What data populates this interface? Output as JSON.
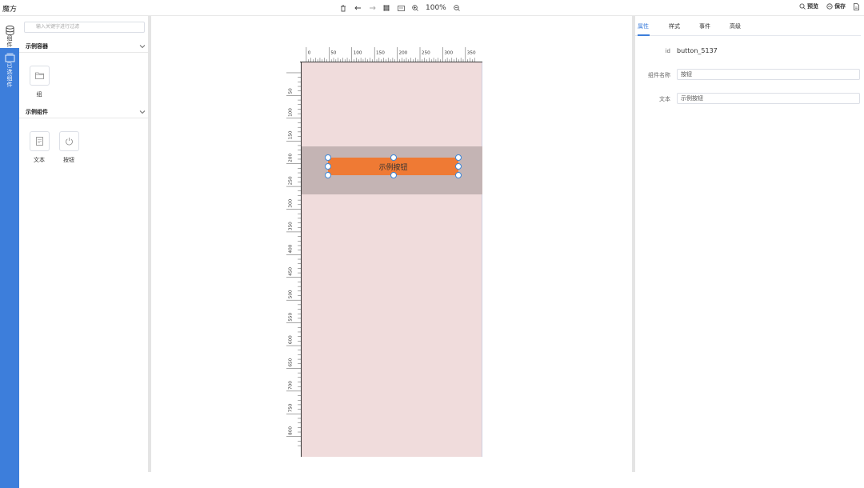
{
  "app": {
    "title": "魔方"
  },
  "toolbar": {
    "zoom": "100%",
    "preview_label": "预览",
    "save_label": "保存"
  },
  "nav": {
    "items": [
      {
        "label": "组件",
        "icon": "database-icon",
        "active": false
      },
      {
        "label": "已选组件",
        "icon": "layers-icon",
        "active": true
      }
    ]
  },
  "left_panel": {
    "search_placeholder": "输入关键字进行过滤",
    "sections": [
      {
        "title": "示例容器",
        "items": [
          {
            "label": "组",
            "icon": "folder-icon"
          }
        ]
      },
      {
        "title": "示例组件",
        "items": [
          {
            "label": "文本",
            "icon": "text-doc-icon"
          },
          {
            "label": "按钮",
            "icon": "power-icon"
          }
        ]
      }
    ]
  },
  "canvas": {
    "ruler_top_labels": [
      "0",
      "50",
      "100",
      "150",
      "200",
      "250",
      "300",
      "350"
    ],
    "ruler_left_labels": [
      "50",
      "100",
      "150",
      "200",
      "250",
      "300",
      "350",
      "400",
      "450",
      "500",
      "550",
      "600",
      "650",
      "700",
      "750",
      "800"
    ],
    "button_text": "示例按钮"
  },
  "right_panel": {
    "tabs": [
      "属性",
      "样式",
      "事件",
      "高级"
    ],
    "active_tab": 0,
    "props": {
      "id_label": "id",
      "id_value": "button_5137",
      "name_label": "组件名称",
      "name_value": "按钮",
      "text_label": "文本",
      "text_value": "示例按钮"
    }
  },
  "colors": {
    "accent": "#3d7edb",
    "button_bg": "#ef7a34",
    "canvas_bg": "#f0dcdc",
    "container_bg": "#c4b4b4"
  }
}
